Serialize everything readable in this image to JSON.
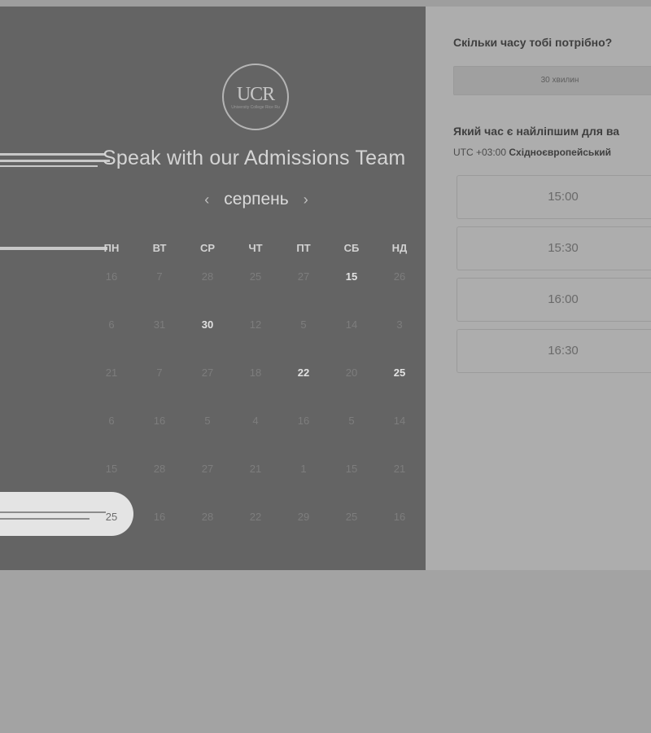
{
  "logo": {
    "text": "UCR",
    "subtext": "University College Rice Ru"
  },
  "calendar": {
    "title": "Speak with our Admissions Team",
    "month": "серпень",
    "weekdays": [
      "ПН",
      "ВТ",
      "СР",
      "ЧТ",
      "ПТ",
      "СБ",
      "НД"
    ],
    "weeks": [
      [
        {
          "d": "16",
          "a": false
        },
        {
          "d": "7",
          "a": false
        },
        {
          "d": "28",
          "a": false
        },
        {
          "d": "25",
          "a": false
        },
        {
          "d": "27",
          "a": false
        },
        {
          "d": "15",
          "a": true
        },
        {
          "d": "26",
          "a": false
        }
      ],
      [
        {
          "d": "6",
          "a": false
        },
        {
          "d": "31",
          "a": false
        },
        {
          "d": "30",
          "a": true
        },
        {
          "d": "12",
          "a": false
        },
        {
          "d": "5",
          "a": false
        },
        {
          "d": "14",
          "a": false
        },
        {
          "d": "3",
          "a": false
        }
      ],
      [
        {
          "d": "21",
          "a": false
        },
        {
          "d": "7",
          "a": false
        },
        {
          "d": "27",
          "a": false
        },
        {
          "d": "18",
          "a": false
        },
        {
          "d": "22",
          "a": true
        },
        {
          "d": "20",
          "a": false
        },
        {
          "d": "25",
          "a": true
        }
      ],
      [
        {
          "d": "6",
          "a": false
        },
        {
          "d": "16",
          "a": false
        },
        {
          "d": "5",
          "a": false
        },
        {
          "d": "4",
          "a": false
        },
        {
          "d": "16",
          "a": false
        },
        {
          "d": "5",
          "a": false
        },
        {
          "d": "14",
          "a": false
        }
      ],
      [
        {
          "d": "15",
          "a": false
        },
        {
          "d": "28",
          "a": false
        },
        {
          "d": "27",
          "a": false
        },
        {
          "d": "21",
          "a": false
        },
        {
          "d": "1",
          "a": false
        },
        {
          "d": "15",
          "a": false
        },
        {
          "d": "21",
          "a": false
        }
      ],
      [
        {
          "d": "25",
          "a": false
        },
        {
          "d": "16",
          "a": false
        },
        {
          "d": "28",
          "a": false
        },
        {
          "d": "22",
          "a": false
        },
        {
          "d": "29",
          "a": false
        },
        {
          "d": "25",
          "a": false
        },
        {
          "d": "16",
          "a": false
        }
      ]
    ]
  },
  "scheduler": {
    "duration_question": "Скільки часу тобі потрібно?",
    "duration_value": "30 хвилин",
    "time_question": "Який час є найліпшим для ва",
    "timezone_offset": "UTC +03:00",
    "timezone_name": "Східноєвропейський",
    "slots": [
      "15:00",
      "15:30",
      "16:00",
      "16:30"
    ]
  }
}
